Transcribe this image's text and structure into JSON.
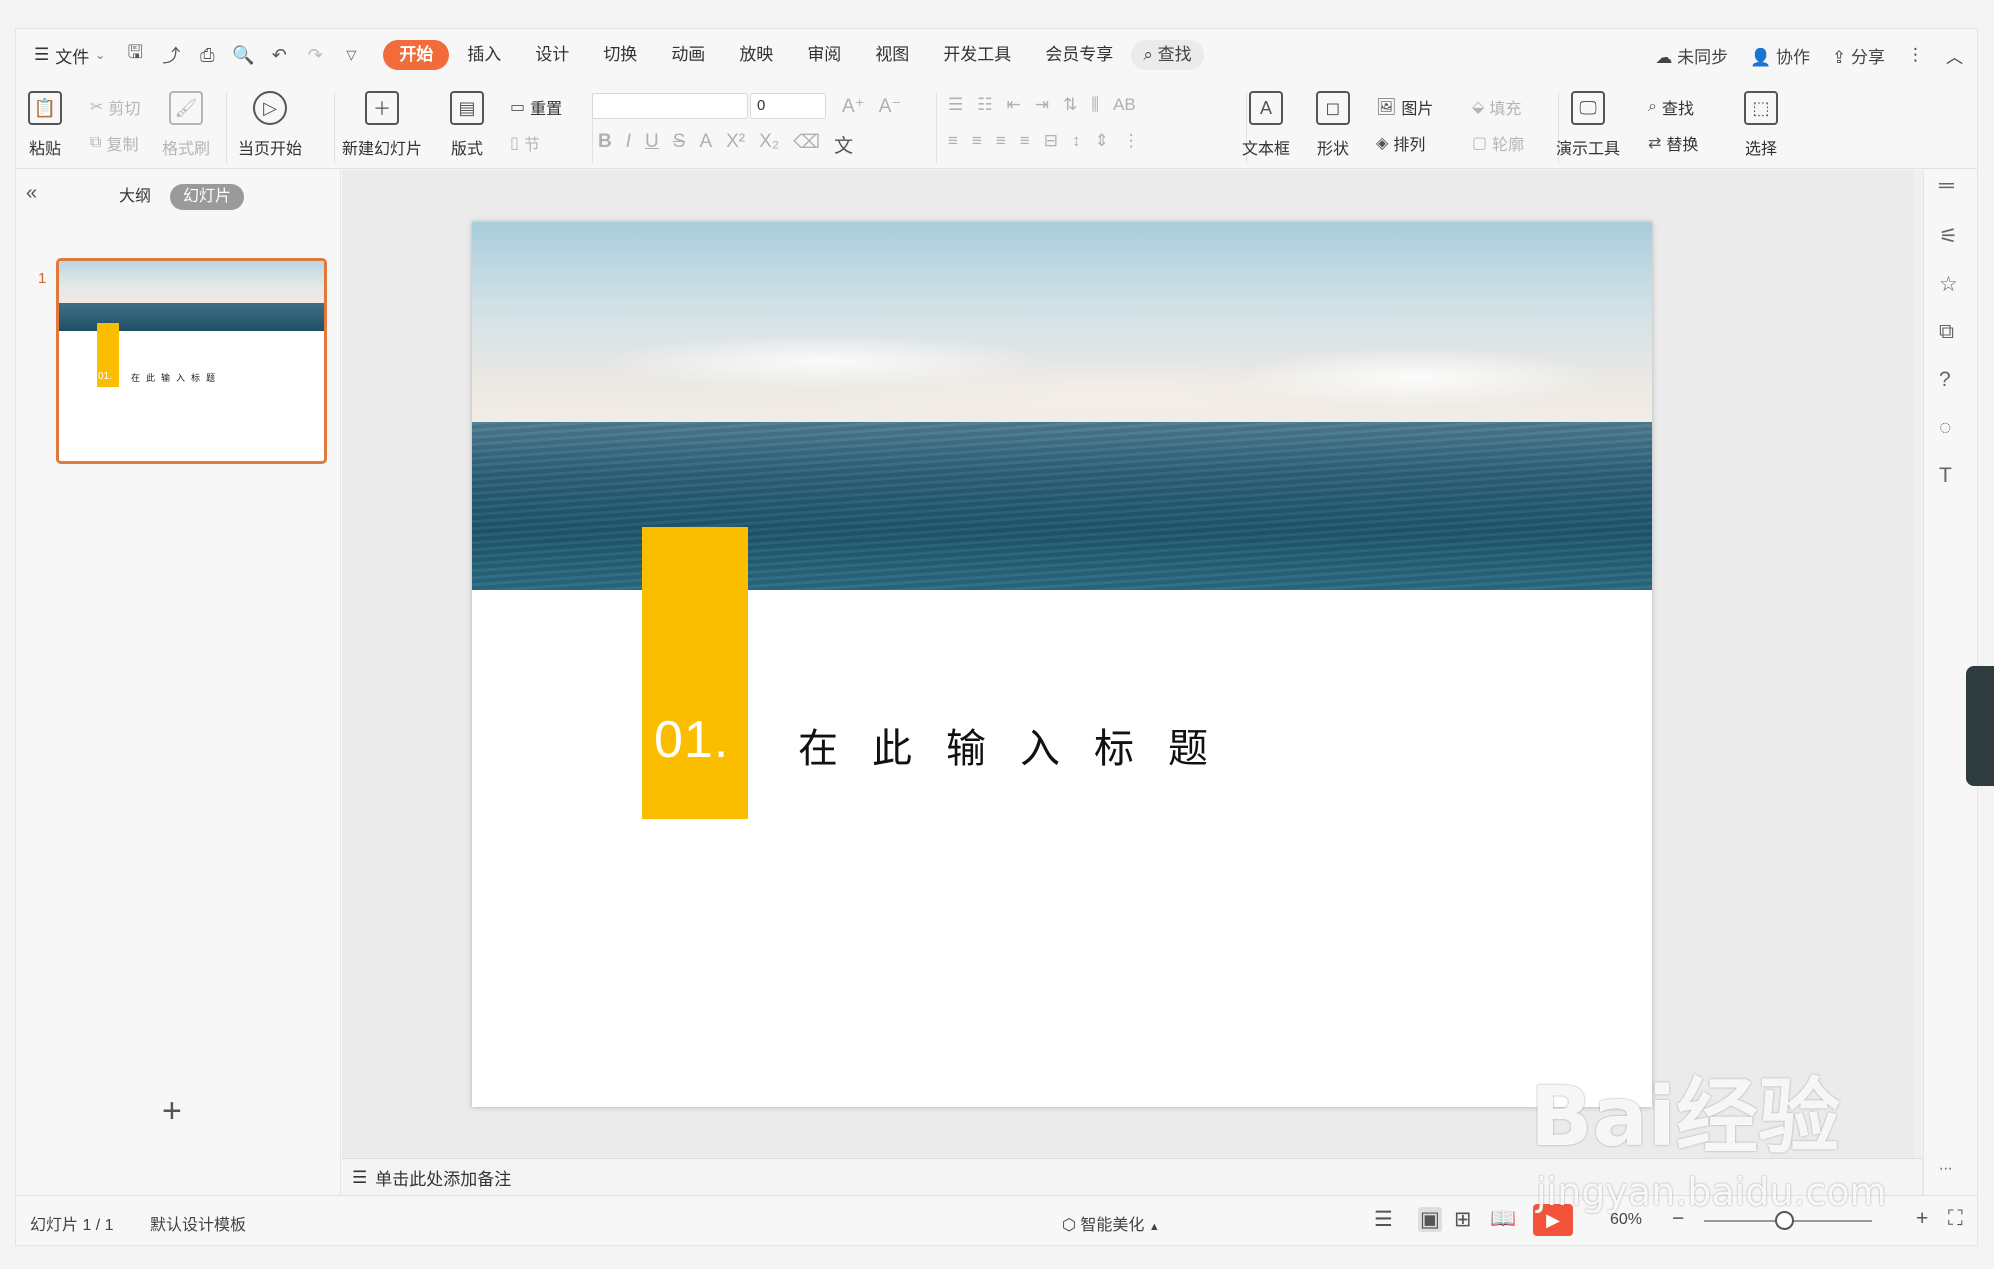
{
  "tabs": {
    "file": "文件",
    "items": [
      "开始",
      "插入",
      "设计",
      "切换",
      "动画",
      "放映",
      "审阅",
      "视图",
      "开发工具",
      "会员专享"
    ],
    "search": "查找"
  },
  "topright": {
    "sync": "未同步",
    "collab": "协作",
    "share": "分享"
  },
  "ribbon": {
    "paste": "粘贴",
    "cut": "剪切",
    "copy": "复制",
    "format_painter": "格式刷",
    "play_current": "当页开始",
    "new_slide": "新建幻灯片",
    "layout": "版式",
    "reset": "重置",
    "section": "节",
    "font_size": "0",
    "textbox": "文本框",
    "shape": "形状",
    "picture": "图片",
    "arrange": "排列",
    "fill": "填充",
    "outline": "轮廓",
    "presenter_tools": "演示工具",
    "find": "查找",
    "replace": "替换",
    "select": "选择"
  },
  "leftpanel": {
    "outline_tab": "大纲",
    "slides_tab": "幻灯片",
    "slide_number": "1"
  },
  "slide": {
    "number": "01.",
    "title": "在此输入标题"
  },
  "notes": {
    "placeholder": "单击此处添加备注"
  },
  "status": {
    "slide_count": "幻灯片 1 / 1",
    "template": "默认设计模板",
    "beautify": "智能美化",
    "zoom": "60%"
  },
  "watermark": {
    "brand": "Bai经验",
    "url": "jingyan.baidu.com"
  },
  "colors": {
    "accent": "#f26b3a",
    "slide_bar": "#fbbd00",
    "thumb_border": "#e07a3c"
  }
}
